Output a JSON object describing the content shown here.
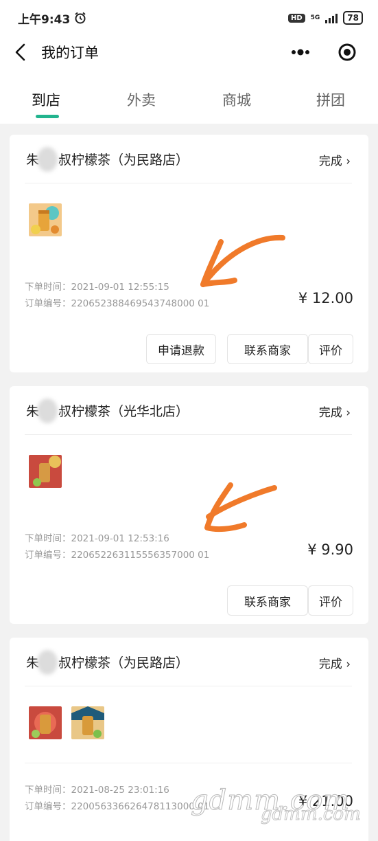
{
  "status_bar": {
    "time": "上午9:43",
    "hd": "HD",
    "network": "5G",
    "battery": "78"
  },
  "nav": {
    "title": "我的订单"
  },
  "tabs": [
    {
      "label": "到店",
      "active": true
    },
    {
      "label": "外卖",
      "active": false
    },
    {
      "label": "商城",
      "active": false
    },
    {
      "label": "拼团",
      "active": false
    }
  ],
  "orders": [
    {
      "store_prefix": "朱",
      "store_suffix": "叔柠檬茶（为民路店）",
      "status": "完成 ›",
      "order_time_label": "下单时间：",
      "order_time": "2021-09-01 12:55:15",
      "order_no_label": "订单编号：",
      "order_no": "220652388469543748000 01",
      "price": "¥ 12.00",
      "buttons": [
        "申请退款",
        "联系商家",
        "评价"
      ]
    },
    {
      "store_prefix": "朱",
      "store_suffix": "叔柠檬茶（光华北店）",
      "status": "完成 ›",
      "order_time_label": "下单时间：",
      "order_time": "2021-09-01 12:53:16",
      "order_no_label": "订单编号：",
      "order_no": "220652263115556357000 01",
      "price": "¥ 9.90",
      "buttons": [
        "联系商家",
        "评价"
      ]
    },
    {
      "store_prefix": "朱",
      "store_suffix": "叔柠檬茶（为民路店）",
      "status": "完成 ›",
      "order_time_label": "下单时间：",
      "order_time": "2021-08-25 23:01:16",
      "order_no_label": "订单编号：",
      "order_no": "220056336626478113000 01",
      "price": "¥ 21.00"
    }
  ],
  "watermark": {
    "main": "gdmm.com",
    "sub": "gdmm.com"
  },
  "colors": {
    "accent": "#22b48e",
    "arrow": "#f07a2a"
  }
}
